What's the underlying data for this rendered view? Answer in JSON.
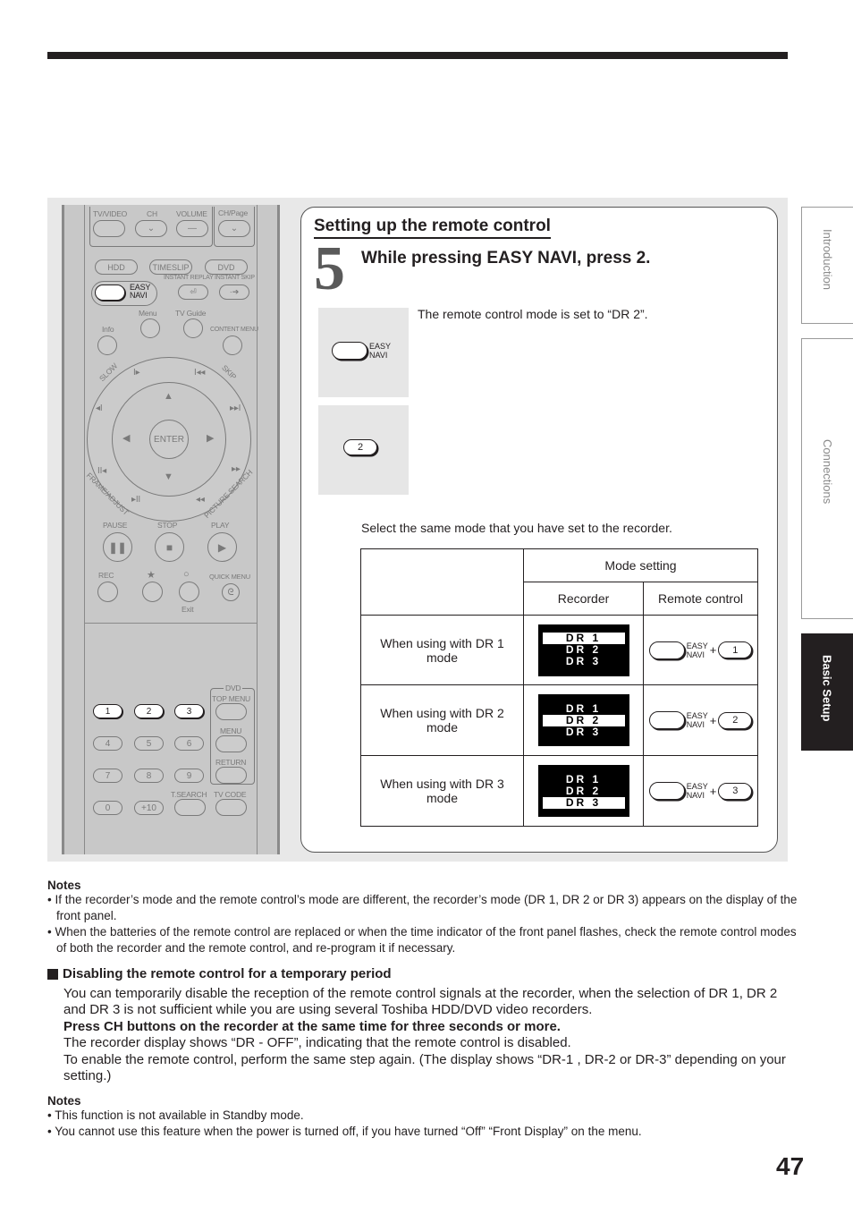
{
  "page": {
    "number": "47",
    "side_tabs": [
      {
        "label": "Introduction",
        "active": false
      },
      {
        "label": "Connections",
        "active": false
      },
      {
        "label": "Basic Setup",
        "active": true
      }
    ]
  },
  "remote": {
    "top_labels": {
      "tv_video": "TV/VIDEO",
      "ch": "CH",
      "volume": "VOLUME",
      "ch_page": "CH/Page"
    },
    "source_buttons": [
      "HDD",
      "TIMESLIP",
      "DVD"
    ],
    "easy_navi": "EASY\nNAVI",
    "instant_replay": "INSTANT REPLAY",
    "instant_skip": "INSTANT SKIP",
    "menu": "Menu",
    "tv_guide": "TV Guide",
    "info": "Info",
    "content_menu": "CONTENT MENU",
    "slow": "SLOW",
    "skip": "SKIP",
    "enter": "ENTER",
    "frame_adjust": "FRAME/ADJUST",
    "picture_search": "PICTURE SEARCH",
    "pause": "PAUSE",
    "stop": "STOP",
    "play": "PLAY",
    "rec": "REC",
    "star": "★",
    "circle": "○",
    "quick_menu": "QUICK MENU",
    "exit": "Exit",
    "dvd": "DVD",
    "top_menu": "TOP MENU",
    "dvd_menu": "MENU",
    "return": "RETURN",
    "t_search": "T.SEARCH",
    "tv_code": "TV CODE",
    "number_keys": [
      "1",
      "2",
      "3",
      "4",
      "5",
      "6",
      "7",
      "8",
      "9",
      "0",
      "+10"
    ],
    "highlighted_keys": [
      "EASY NAVI",
      "1",
      "2",
      "3"
    ]
  },
  "card": {
    "section_title": "Setting up the remote control",
    "step_number": "5",
    "step_instruction": "While pressing EASY NAVI, press 2.",
    "easy_navi_label_line1": "EASY",
    "easy_navi_label_line2": "NAVI",
    "key_2_label": "2",
    "result_text": "The remote control mode is set to “DR 2”.",
    "select_text": "Select the same mode that you have set to the recorder.",
    "table": {
      "header_group": "Mode setting",
      "col_recorder": "Recorder",
      "col_remote": "Remote control",
      "display_lines": [
        "DR 1",
        "DR 2",
        "DR 3"
      ],
      "plus": "+",
      "rows": [
        {
          "label": "When using with DR 1 mode",
          "selected_index": 0,
          "key": "1"
        },
        {
          "label": "When using with DR 2 mode",
          "selected_index": 1,
          "key": "2"
        },
        {
          "label": "When using with DR 3 mode",
          "selected_index": 2,
          "key": "3"
        }
      ]
    }
  },
  "notes1": {
    "heading": "Notes",
    "items": [
      "• If the recorder’s mode and the remote control’s mode are different, the recorder’s mode (DR 1, DR 2 or DR 3) appears on the display of the front panel.",
      "• When the batteries of the remote control are replaced or when the time indicator of the front panel flashes, check the remote control modes of both the recorder and the remote control, and re-program it if necessary."
    ]
  },
  "disable": {
    "heading": "Disabling the remote control for a temporary period",
    "p1": "You can temporarily disable the reception of the remote control signals at the recorder, when the selection of DR 1, DR 2 and DR 3 is not sufficient while you are using several Toshiba HDD/DVD video recorders.",
    "p2_bold": "Press CH buttons on the recorder at the same time for three seconds or more.",
    "p3": "The recorder display shows “DR - OFF”, indicating that the remote control is disabled.",
    "p4": "To enable the remote control, perform the same step again. (The display shows “DR-1 , DR-2 or DR-3” depending on your setting.)"
  },
  "notes2": {
    "heading": "Notes",
    "items": [
      "• This function is not available in Standby mode.",
      "• You cannot use this feature when the power is turned off, if you have turned “Off” “Front Display” on the menu."
    ]
  }
}
